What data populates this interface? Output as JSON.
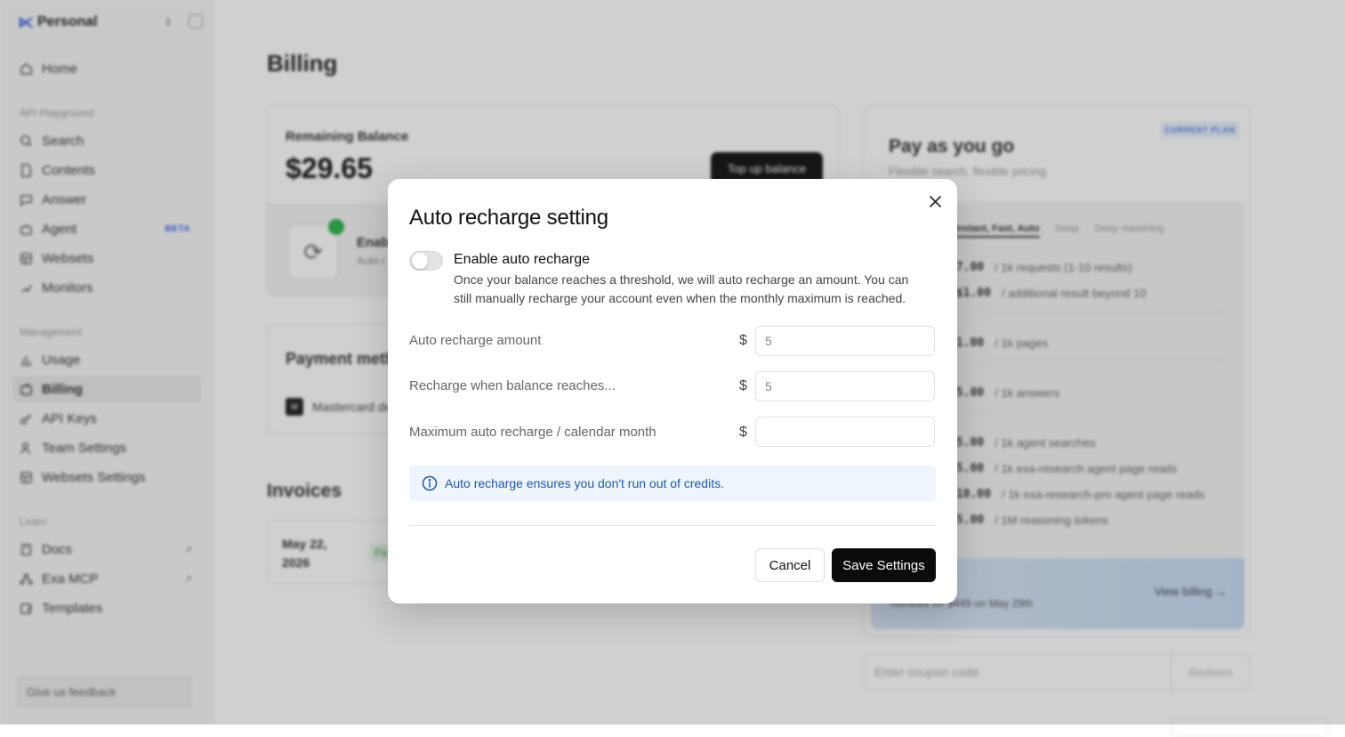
{
  "sidebar": {
    "workspace": "Personal",
    "items": [
      {
        "label": "Home"
      },
      {
        "label": "Search"
      },
      {
        "label": "Contents"
      },
      {
        "label": "Answer"
      },
      {
        "label": "Agent",
        "badge": "BETA"
      },
      {
        "label": "Websets"
      },
      {
        "label": "Monitors"
      },
      {
        "label": "Usage"
      },
      {
        "label": "Billing"
      },
      {
        "label": "API Keys"
      },
      {
        "label": "Team Settings"
      },
      {
        "label": "Websets Settings"
      },
      {
        "label": "Docs",
        "ext": "↗"
      },
      {
        "label": "Exa MCP",
        "ext": "↗"
      },
      {
        "label": "Templates"
      }
    ],
    "sections": [
      "API Playground",
      "Management",
      "Learn"
    ],
    "feedback": "Give us feedback"
  },
  "main": {
    "title": "Billing",
    "balance": {
      "label": "Remaining Balance",
      "amount": "$29.65",
      "topup": "Top up balance",
      "enab": "Enab",
      "auto": "Auto r"
    },
    "payment": {
      "title": "Payment meth",
      "card": "Mastercard de",
      "mc": "M"
    },
    "invoices": {
      "title": "Invoices",
      "date": "May 22, 2026",
      "pill": "Pa"
    }
  },
  "plan": {
    "title": "Pay as you go",
    "subtitle": "Flexible search, flexible pricing",
    "badge": "CURRENT PLAN",
    "tabs": [
      "Instant, Fast, Auto",
      "Deep",
      "Deep reasoning"
    ],
    "prices": [
      {
        "value": "$7.00",
        "desc": "/ 1k requests (1-10 results)"
      },
      {
        "value": "+$1.00",
        "desc": "/ additional result beyond 10"
      },
      {
        "value": "$1.00",
        "desc": "/ 1k pages"
      },
      {
        "value": "$5.00",
        "desc": "/ 1k answers"
      },
      {
        "value": "$5.00",
        "desc": "/ 1k agent searches"
      },
      {
        "value": "$5.00",
        "desc": "/ 1k exa-research agent page reads"
      },
      {
        "value": "$10.00",
        "desc": "/ 1k exa-research-pro agent page reads"
      },
      {
        "value": "$5.00",
        "desc": "/ 1M reasoning tokens"
      }
    ],
    "banner_text": "Renews for $449 on May 29th",
    "banner_link": "View billing →"
  },
  "coupon": {
    "placeholder": "Enter coupon code",
    "redeem": "Redeem"
  },
  "modal": {
    "title": "Auto recharge setting",
    "toggle_title": "Enable auto recharge",
    "toggle_enabled": false,
    "toggle_desc": "Once your balance reaches a threshold, we will auto recharge an amount. You can still manually recharge your account even when the monthly maximum is reached.",
    "currency": "$",
    "fields": [
      {
        "label": "Auto recharge amount",
        "value": "5"
      },
      {
        "label": "Recharge when balance reaches...",
        "value": "5"
      },
      {
        "label": "Maximum auto recharge / calendar month",
        "value": ""
      }
    ],
    "info": "Auto recharge ensures you don't run out of credits.",
    "cancel": "Cancel",
    "save": "Save Settings"
  },
  "colors": {
    "accent": "#2b55e6",
    "info_text": "#2256a8",
    "info_bg": "#eef5fc",
    "primary_button": "#0b0b0b"
  }
}
